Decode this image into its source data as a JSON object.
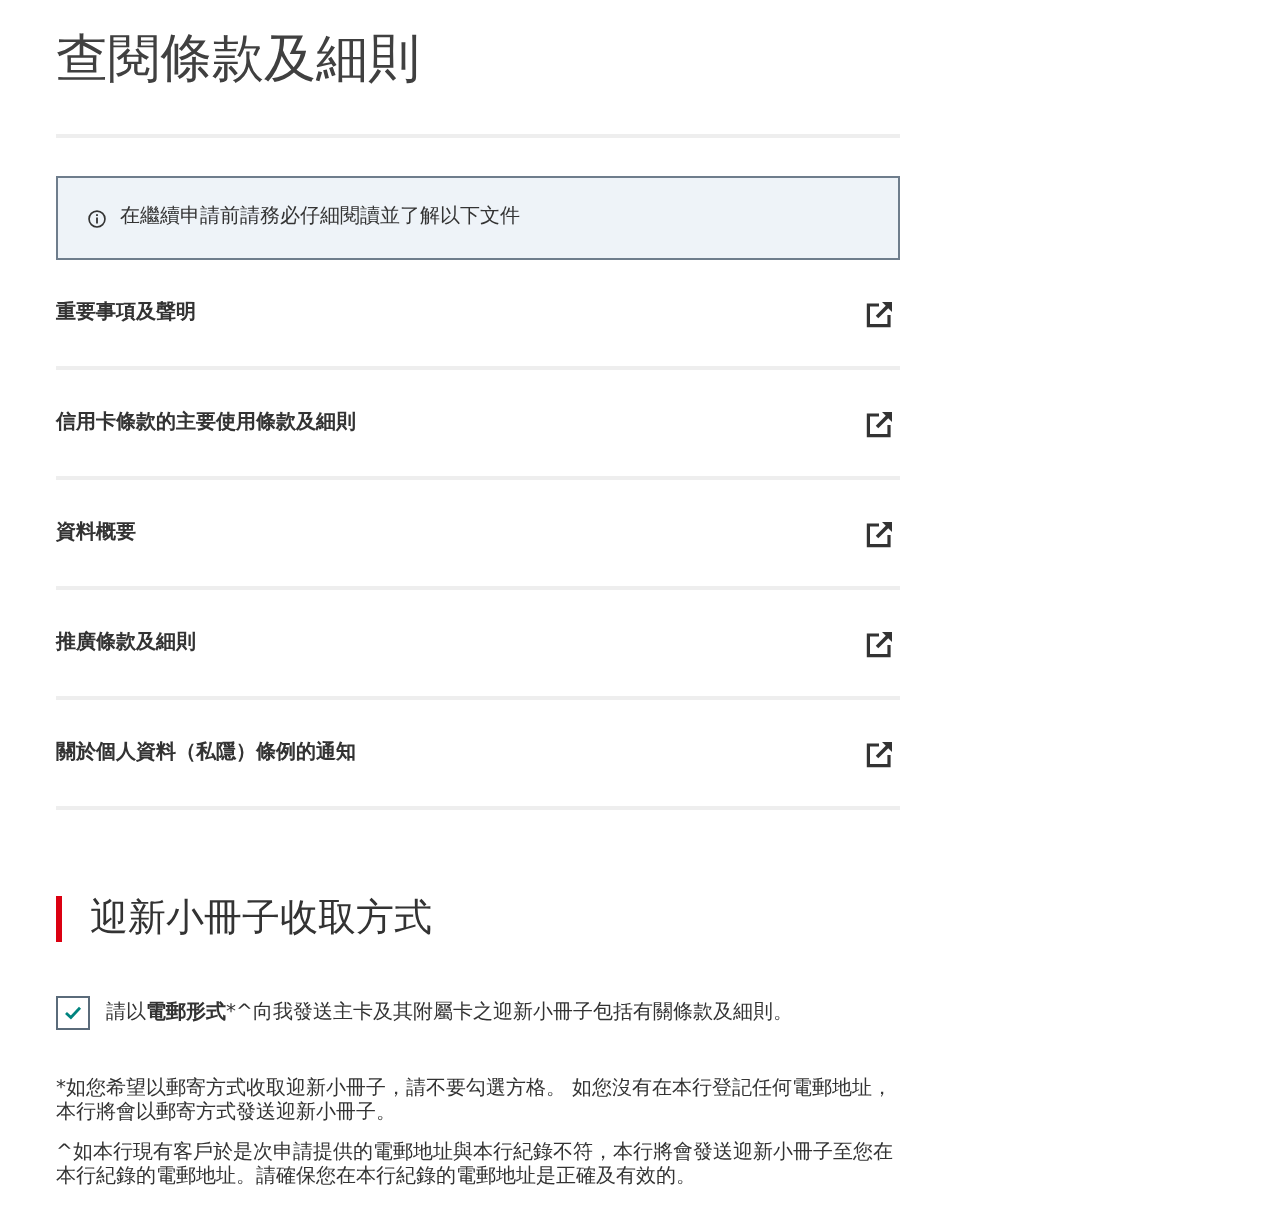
{
  "page": {
    "title": "查閱條款及細則"
  },
  "notice": {
    "text": "在繼續申請前請務必仔細閱讀並了解以下文件"
  },
  "documents": [
    {
      "label": "重要事項及聲明"
    },
    {
      "label": "信用卡條款的主要使用條款及細則"
    },
    {
      "label": "資料概要"
    },
    {
      "label": "推廣條款及細則"
    },
    {
      "label": "關於個人資料（私隱）條例的通知"
    }
  ],
  "booklet_section": {
    "heading": "迎新小冊子收取方式",
    "email_option": {
      "checked": true,
      "label_parts": [
        {
          "text": "請以",
          "bold": false
        },
        {
          "text": "電郵形式",
          "bold": true
        },
        {
          "text": "*^向我發送主卡及其附屬卡之迎新小冊子包括有關條款及細則。",
          "bold": false
        }
      ]
    },
    "notes": [
      "*如您希望以郵寄方式收取迎新小冊子，請不要勾選方格。 如您沒有在本行登記任何電郵地址，本行將會以郵寄方式發送迎新小冊子。",
      "^如本行現有客戶於是次申請提供的電郵地址與本行紀錄不符，本行將會發送迎新小冊子至您在本行紀錄的電郵地址。請確保您在本行紀錄的電郵地址是正確及有效的。"
    ]
  }
}
